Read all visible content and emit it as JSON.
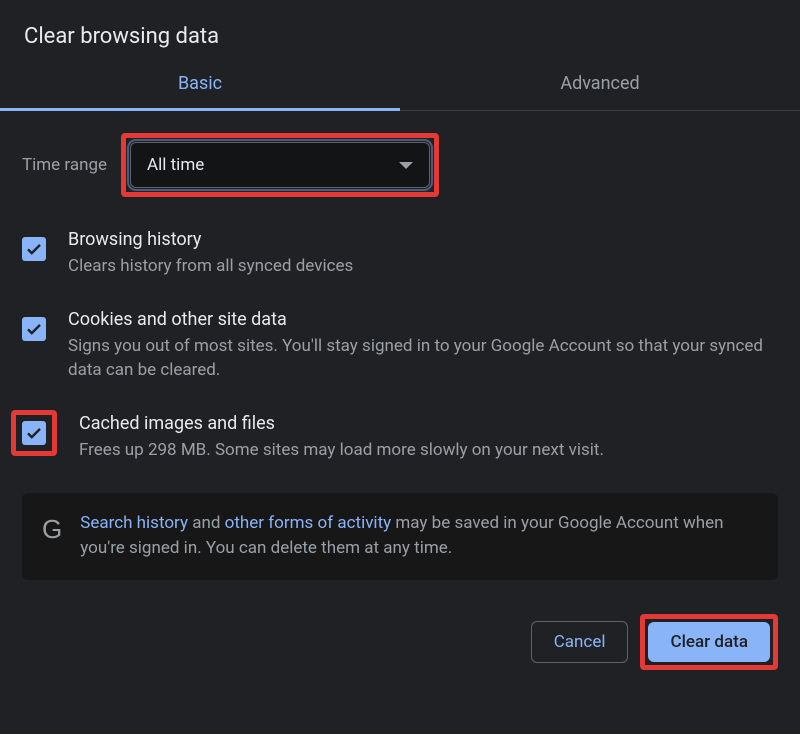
{
  "dialog": {
    "title": "Clear browsing data"
  },
  "tabs": {
    "basic": "Basic",
    "advanced": "Advanced"
  },
  "timeRange": {
    "label": "Time range",
    "value": "All time"
  },
  "items": {
    "browsing": {
      "title": "Browsing history",
      "desc": "Clears history from all synced devices"
    },
    "cookies": {
      "title": "Cookies and other site data",
      "desc": "Signs you out of most sites. You'll stay signed in to your Google Account so that your synced data can be cleared."
    },
    "cached": {
      "title": "Cached images and files",
      "desc": "Frees up 298 MB. Some sites may load more slowly on your next visit."
    }
  },
  "info": {
    "link1": "Search history",
    "mid1": " and ",
    "link2": "other forms of activity",
    "tail": " may be saved in your Google Account when you're signed in. You can delete them at any time."
  },
  "buttons": {
    "cancel": "Cancel",
    "clear": "Clear data"
  }
}
